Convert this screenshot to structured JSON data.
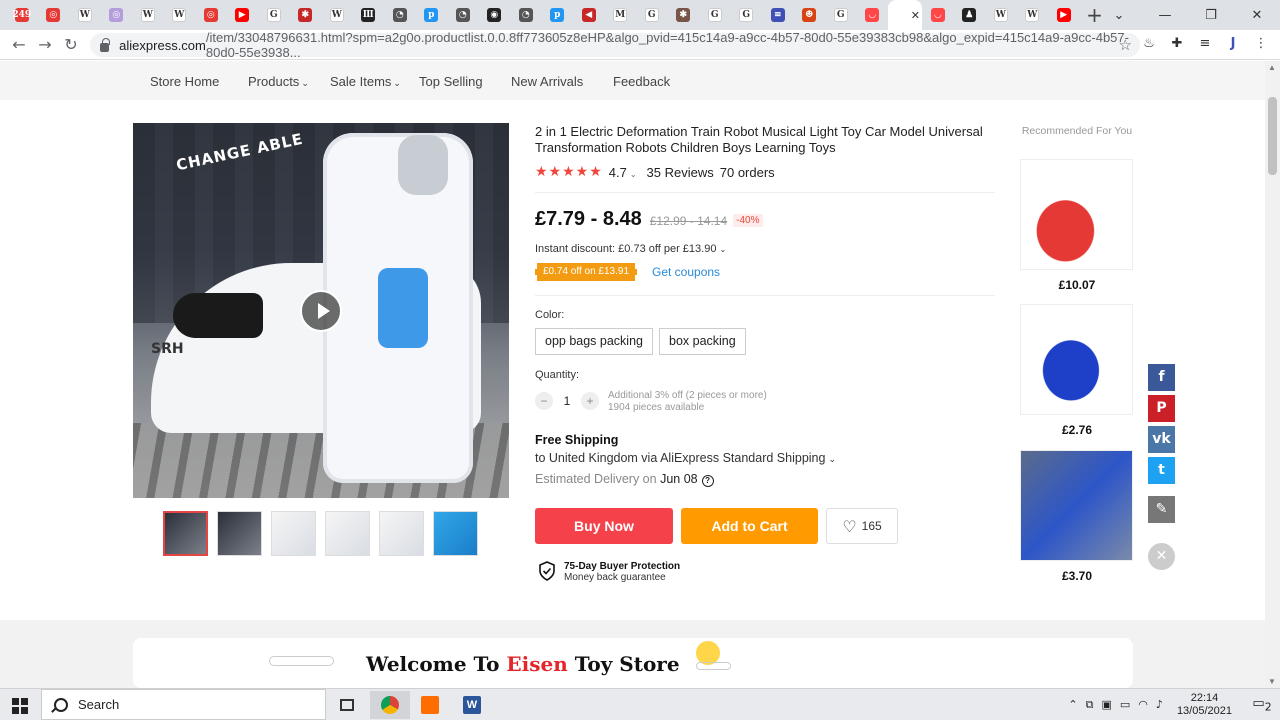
{
  "browser": {
    "tabs": [
      {
        "icon": "red-badge-icon",
        "label": "249",
        "color": "#e53935"
      },
      {
        "icon": "target-icon",
        "label": "◎",
        "color": "#e53935"
      },
      {
        "icon": "wikipedia-icon",
        "label": "W",
        "color": "#ffffff"
      },
      {
        "icon": "purple-circle-icon",
        "label": "◎",
        "color": "#b39ddb"
      },
      {
        "icon": "wikipedia-icon",
        "label": "W",
        "color": "#ffffff"
      },
      {
        "icon": "wikipedia-icon",
        "label": "W",
        "color": "#ffffff"
      },
      {
        "icon": "target-icon",
        "label": "◎",
        "color": "#e53935"
      },
      {
        "icon": "youtube-icon",
        "label": "▶",
        "color": "#ff0000"
      },
      {
        "icon": "google-icon",
        "label": "G",
        "color": "#ffffff"
      },
      {
        "icon": "crest-icon",
        "label": "✱",
        "color": "#c62828"
      },
      {
        "icon": "wikipedia-icon",
        "label": "W",
        "color": "#ffffff"
      },
      {
        "icon": "museum-icon",
        "label": "Ⅲ",
        "color": "#222222"
      },
      {
        "icon": "circle-dark-icon",
        "label": "◔",
        "color": "#555555"
      },
      {
        "icon": "p-blue-icon",
        "label": "p",
        "color": "#2196f3"
      },
      {
        "icon": "circle-dark-icon",
        "label": "◔",
        "color": "#555555"
      },
      {
        "icon": "medium-icon",
        "label": "◉",
        "color": "#222222"
      },
      {
        "icon": "circle-dark-icon",
        "label": "◔",
        "color": "#555555"
      },
      {
        "icon": "p-blue-icon",
        "label": "p",
        "color": "#2196f3"
      },
      {
        "icon": "speaker-icon",
        "label": "◀",
        "color": "#c62828"
      },
      {
        "icon": "gmail-icon",
        "label": "M",
        "color": "#ffffff"
      },
      {
        "icon": "google-icon",
        "label": "G",
        "color": "#ffffff"
      },
      {
        "icon": "crest-icon",
        "label": "✱",
        "color": "#795548"
      },
      {
        "icon": "google-icon",
        "label": "G",
        "color": "#ffffff"
      },
      {
        "icon": "google-icon",
        "label": "G",
        "color": "#ffffff"
      },
      {
        "icon": "news-icon",
        "label": "≡",
        "color": "#3f51b5"
      },
      {
        "icon": "figure-icon",
        "label": "☻",
        "color": "#d84315"
      },
      {
        "icon": "google-icon",
        "label": "G",
        "color": "#ffffff"
      },
      {
        "icon": "aliexpress-icon",
        "label": "◡",
        "color": "#ff4747"
      }
    ],
    "tabs_after": [
      {
        "icon": "aliexpress-icon",
        "label": "◡",
        "color": "#ff4747"
      },
      {
        "icon": "person-icon",
        "label": "♟",
        "color": "#222222"
      },
      {
        "icon": "wikipedia-icon",
        "label": "W",
        "color": "#ffffff"
      },
      {
        "icon": "wikipedia-icon",
        "label": "W",
        "color": "#ffffff"
      },
      {
        "icon": "youtube-icon",
        "label": "▶",
        "color": "#ff0000"
      }
    ],
    "new_tab": "+",
    "window_controls": {
      "menu": "⌄",
      "minimize": "—",
      "maximize": "❐",
      "close": "✕"
    },
    "url_domain": "aliexpress.com",
    "url_rest": "/item/33048796631.html?spm=a2g0o.productlist.0.0.8ff773605z8eHP&algo_pvid=415c14a9-a9cc-4b57-80d0-55e39383cb98&algo_expid=415c14a9-a9cc-4b57-80d0-55e3938..."
  },
  "store_nav": {
    "items": [
      "Store Home",
      "Products",
      "Sale Items",
      "Top Selling",
      "New Arrivals",
      "Feedback"
    ]
  },
  "product": {
    "image_label": "CHANGE ABLE",
    "image_brand": "SRH",
    "title": "2 in 1 Electric Deformation Train Robot Musical Light Toy Car Model Universal Transformation Robots Children Boys Learning Toys",
    "stars": "★★★★★",
    "rating": "4.7",
    "reviews": "35 Reviews",
    "orders": "70 orders",
    "price": "£7.79 - 8.48",
    "original_price": "£12.99 - 14.14",
    "discount": "-40%",
    "instant_discount": "Instant discount: £0.73 off per £13.90",
    "coupon": "£0.74 off on £13.91",
    "get_coupons": "Get coupons",
    "color_label": "Color:",
    "options": [
      "opp bags packing",
      "box packing"
    ],
    "quantity_label": "Quantity:",
    "quantity": "1",
    "qty_note_1": "Additional 3% off (2 pieces or more)",
    "qty_note_2": "1904 pieces available",
    "shipping_title": "Free Shipping",
    "shipping_detail": "to United Kingdom via AliExpress Standard Shipping",
    "delivery_label": "Estimated Delivery on",
    "delivery_date": "Jun 08",
    "buy_now": "Buy Now",
    "add_to_cart": "Add to Cart",
    "wishlist_count": "165",
    "protection_title": "75-Day Buyer Protection",
    "protection_sub": "Money back guarantee"
  },
  "recommended": {
    "title": "Recommended For You",
    "items": [
      {
        "price": "£10.07",
        "color": "#e53935"
      },
      {
        "price": "£2.76",
        "color": "#1e40c8"
      },
      {
        "price": "£3.70",
        "color": "#2d56c8"
      }
    ]
  },
  "share": [
    {
      "icon": "facebook-icon",
      "label": "f",
      "color": "#3b5998"
    },
    {
      "icon": "pinterest-icon",
      "label": "P",
      "color": "#cb2027"
    },
    {
      "icon": "vk-icon",
      "label": "vk",
      "color": "#4a76a8"
    },
    {
      "icon": "twitter-icon",
      "label": "t",
      "color": "#1da1f2"
    },
    {
      "icon": "edit-icon",
      "label": "✎",
      "color": "#777777"
    }
  ],
  "welcome": {
    "prefix": "Welcome To ",
    "name": "Eisen",
    "suffix": " Toy Store"
  },
  "taskbar": {
    "search": "Search",
    "time": "22:14",
    "date": "13/05/2021",
    "notifications": "2"
  }
}
